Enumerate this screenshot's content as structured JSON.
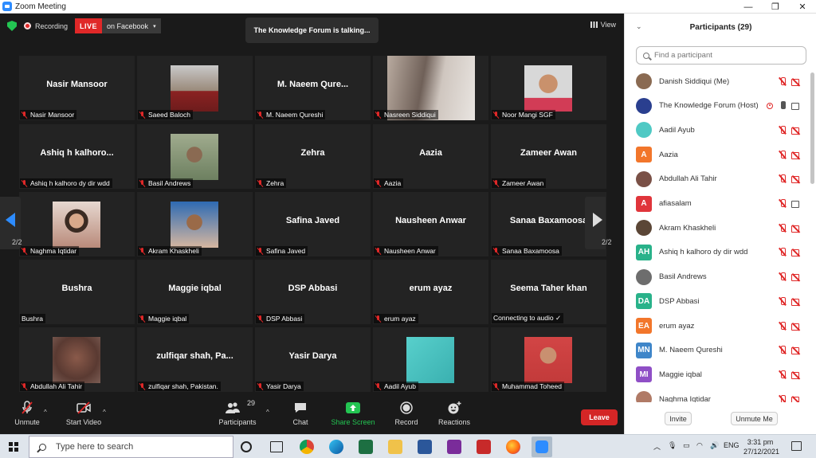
{
  "window": {
    "title": "Zoom Meeting",
    "minimize": "—",
    "maximize": "❐",
    "close": "✕"
  },
  "topbar": {
    "recording": "Recording",
    "live": "LIVE",
    "live_target": "on Facebook",
    "live_caret": "▾",
    "talking": "The Knowledge Forum is talking...",
    "view": "View"
  },
  "tiles": [
    {
      "name": "Nasir Mansoor",
      "label": "Nasir Mansoor",
      "video": false
    },
    {
      "name": "",
      "label": "Saeed Baloch",
      "video": true
    },
    {
      "name": "M. Naeem Qure...",
      "label": "M. Naeem Qureshi",
      "video": false
    },
    {
      "name": "",
      "label": "Nasreen Siddiqui",
      "video": true
    },
    {
      "name": "",
      "label": "Noor Mangi SGF",
      "video": true
    },
    {
      "name": "Ashiq h kalhoro...",
      "label": "Ashiq h kalhoro dy dir wdd",
      "video": false
    },
    {
      "name": "",
      "label": "Basil Andrews",
      "video": true
    },
    {
      "name": "Zehra",
      "label": "Zehra",
      "video": false
    },
    {
      "name": "Aazia",
      "label": "Aazia",
      "video": false
    },
    {
      "name": "Zameer Awan",
      "label": "Zameer Awan",
      "video": false
    },
    {
      "name": "",
      "label": "Naghma Iqtidar",
      "video": true
    },
    {
      "name": "",
      "label": "Akram Khaskheli",
      "video": true
    },
    {
      "name": "Safina Javed",
      "label": "Safina Javed",
      "video": false
    },
    {
      "name": "Nausheen Anwar",
      "label": "Nausheen Anwar",
      "video": false
    },
    {
      "name": "Sanaa Baxamoosa",
      "label": "Sanaa Baxamoosa",
      "video": false
    },
    {
      "name": "Bushra",
      "label": "Bushra",
      "video": false
    },
    {
      "name": "Maggie iqbal",
      "label": "Maggie iqbal",
      "video": false
    },
    {
      "name": "DSP Abbasi",
      "label": "DSP Abbasi",
      "video": false
    },
    {
      "name": "erum ayaz",
      "label": "erum ayaz",
      "video": false
    },
    {
      "name": "Seema Taher khan",
      "label": "Connecting to audio ✓",
      "video": false
    },
    {
      "name": "",
      "label": "Abdullah Ali Tahir",
      "video": true
    },
    {
      "name": "zulfiqar shah, Pa...",
      "label": "zulfiqar shah, Pakistan.",
      "video": false
    },
    {
      "name": "Yasir Darya",
      "label": "Yasir Darya",
      "video": false
    },
    {
      "name": "",
      "label": "Aadil Ayub",
      "video": true
    },
    {
      "name": "",
      "label": "Muhammad Toheed",
      "video": true
    }
  ],
  "pager": {
    "left": "2/2",
    "right": "2/2"
  },
  "toolbar": {
    "unmute": "Unmute",
    "start_video": "Start Video",
    "participants": "Participants",
    "participants_count": "29",
    "chat": "Chat",
    "share_screen": "Share Screen",
    "record": "Record",
    "reactions": "Reactions",
    "leave": "Leave",
    "caret": "^"
  },
  "panel": {
    "title": "Participants (29)",
    "collapse": "⌄",
    "search_placeholder": "Find a participant",
    "invite": "Invite",
    "unmute_me": "Unmute Me",
    "participants": [
      {
        "name": "Danish Siddiqui (Me)",
        "initials": "",
        "color": "#8a6a52",
        "photo": true,
        "mic": "muted",
        "cam": "off"
      },
      {
        "name": "The Knowledge Forum (Host)",
        "initials": "",
        "color": "#2a3f8f",
        "photo": true,
        "mic": "on",
        "cam": "on",
        "recording": true
      },
      {
        "name": "Aadil Ayub",
        "initials": "",
        "color": "#4fc9c4",
        "photo": true,
        "mic": "muted",
        "cam": "off"
      },
      {
        "name": "Aazia",
        "initials": "A",
        "color": "#f2762b",
        "photo": false,
        "mic": "muted",
        "cam": "off"
      },
      {
        "name": "Abdullah Ali Tahir",
        "initials": "",
        "color": "#7a5046",
        "photo": true,
        "mic": "muted",
        "cam": "off"
      },
      {
        "name": "afiasalam",
        "initials": "A",
        "color": "#e0353b",
        "photo": false,
        "mic": "muted",
        "cam": "on"
      },
      {
        "name": "Akram Khaskheli",
        "initials": "",
        "color": "#5b4636",
        "photo": true,
        "mic": "muted",
        "cam": "off"
      },
      {
        "name": "Ashiq h kalhoro dy dir wdd",
        "initials": "AH",
        "color": "#29b28a",
        "photo": false,
        "mic": "muted",
        "cam": "off"
      },
      {
        "name": "Basil Andrews",
        "initials": "",
        "color": "#6d6d6d",
        "photo": true,
        "mic": "muted",
        "cam": "off"
      },
      {
        "name": "DSP Abbasi",
        "initials": "DA",
        "color": "#29b28a",
        "photo": false,
        "mic": "muted",
        "cam": "off"
      },
      {
        "name": "erum ayaz",
        "initials": "EA",
        "color": "#f2762b",
        "photo": false,
        "mic": "muted",
        "cam": "off"
      },
      {
        "name": "M. Naeem Qureshi",
        "initials": "MN",
        "color": "#3f86c9",
        "photo": false,
        "mic": "muted",
        "cam": "off"
      },
      {
        "name": "Maggie iqbal",
        "initials": "MI",
        "color": "#8f4fc6",
        "photo": false,
        "mic": "muted",
        "cam": "off"
      },
      {
        "name": "Naghma Iqtidar",
        "initials": "",
        "color": "#b07a66",
        "photo": true,
        "mic": "muted",
        "cam": "off"
      }
    ]
  },
  "taskbar": {
    "search_placeholder": "Type here to search",
    "lang": "ENG",
    "time": "3:31 pm",
    "date": "27/12/2021"
  }
}
